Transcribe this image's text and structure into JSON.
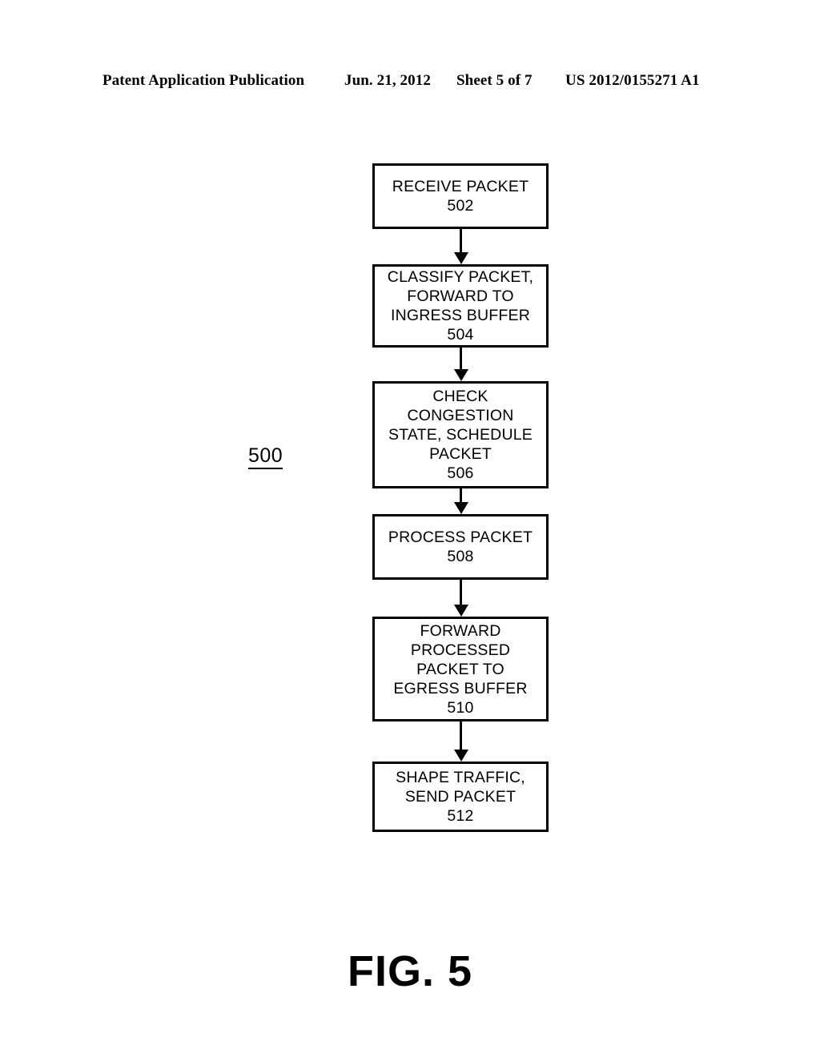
{
  "header": {
    "publication": "Patent Application Publication",
    "date": "Jun. 21, 2012",
    "sheet": "Sheet 5 of 7",
    "patent_number": "US 2012/0155271 A1"
  },
  "figure": {
    "caption": "FIG. 5",
    "diagram_ref": "500",
    "type": "flowchart",
    "orientation": "vertical-top-to-bottom",
    "nodes": [
      {
        "ref": "502",
        "lines": [
          "RECEIVE PACKET"
        ]
      },
      {
        "ref": "504",
        "lines": [
          "CLASSIFY PACKET,",
          "FORWARD TO",
          "INGRESS BUFFER"
        ]
      },
      {
        "ref": "506",
        "lines": [
          "CHECK",
          "CONGESTION",
          "STATE, SCHEDULE",
          "PACKET"
        ]
      },
      {
        "ref": "508",
        "lines": [
          "PROCESS PACKET"
        ]
      },
      {
        "ref": "510",
        "lines": [
          "FORWARD",
          "PROCESSED",
          "PACKET TO",
          "EGRESS BUFFER"
        ]
      },
      {
        "ref": "512",
        "lines": [
          "SHAPE TRAFFIC,",
          "SEND PACKET"
        ]
      }
    ],
    "edges": [
      {
        "from": "502",
        "to": "504",
        "arrow": "down-arrow"
      },
      {
        "from": "504",
        "to": "506",
        "arrow": "down-arrow"
      },
      {
        "from": "506",
        "to": "508",
        "arrow": "down-arrow"
      },
      {
        "from": "508",
        "to": "510",
        "arrow": "down-arrow"
      },
      {
        "from": "510",
        "to": "512",
        "arrow": "down-arrow"
      }
    ]
  },
  "colors": {
    "ink": "#000000",
    "paper": "#ffffff"
  }
}
